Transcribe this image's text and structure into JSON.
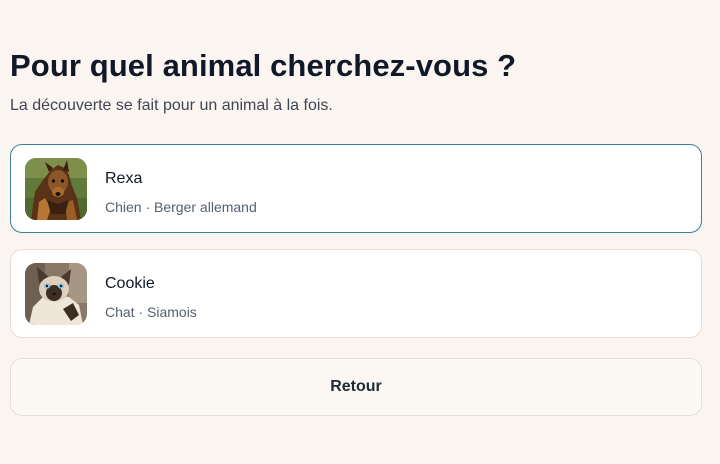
{
  "header": {
    "title": "Pour quel animal cherchez-vous ?",
    "subtitle": "La découverte se fait pour un animal à la fois."
  },
  "pets": [
    {
      "name": "Rexa",
      "info": "Chien · Berger allemand",
      "selected": true,
      "avatar_icon": "german-shepherd-photo"
    },
    {
      "name": "Cookie",
      "info": "Chat · Siamois",
      "selected": false,
      "avatar_icon": "siamese-cat-photo"
    }
  ],
  "actions": {
    "back_label": "Retour"
  },
  "colors": {
    "background": "#faf5f0",
    "selected_border": "#3d7f92",
    "card_border": "#e6dfd7",
    "text_primary": "#111827",
    "text_secondary": "#556070"
  }
}
